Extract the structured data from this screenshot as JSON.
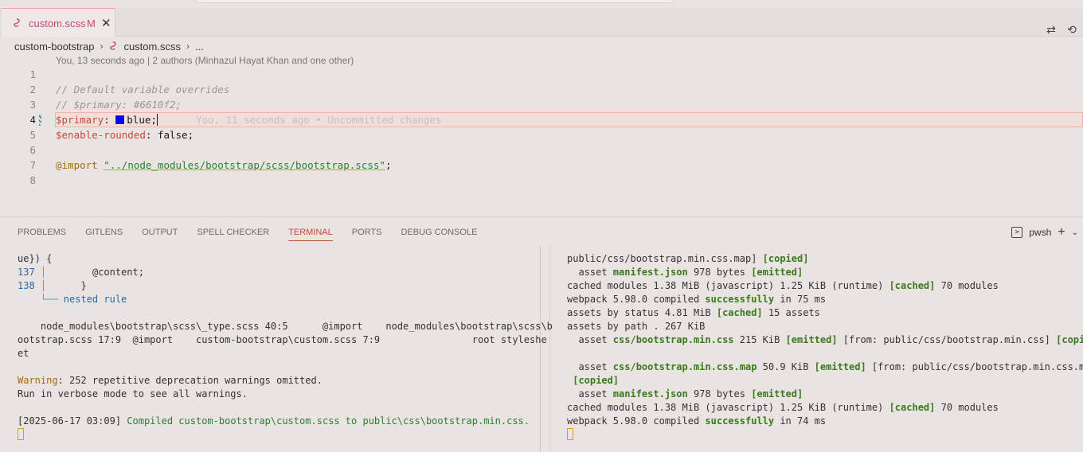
{
  "tab": {
    "filename": "custom.scss",
    "modified": "M",
    "close": "✕"
  },
  "breadcrumb": {
    "folder": "custom-bootstrap",
    "file": "custom.scss",
    "more": "..."
  },
  "blame": "You, 13 seconds ago | 2 authors (Minhazul Hayat Khan and one other)",
  "editor": {
    "lines": [
      {
        "n": "1"
      },
      {
        "n": "2",
        "comment": "// Default variable overrides"
      },
      {
        "n": "3",
        "comment": "// $primary: #6610f2;"
      },
      {
        "n": "4",
        "var": "$primary",
        "colon": ": ",
        "value": "blue",
        "semi": ";",
        "ghost": "You, 11 seconds ago • Uncommitted changes"
      },
      {
        "n": "5",
        "var": "$enable-rounded",
        "colon": ": ",
        "value": "false",
        "semi": ";"
      },
      {
        "n": "6"
      },
      {
        "n": "7",
        "kw": "@import",
        "str": "\"../node_modules/bootstrap/scss/bootstrap.scss\"",
        "semi": ";"
      },
      {
        "n": "8"
      }
    ],
    "swatch_color": "#0000ff"
  },
  "panel": {
    "tabs": [
      "PROBLEMS",
      "GITLENS",
      "OUTPUT",
      "SPELL CHECKER",
      "TERMINAL",
      "PORTS",
      "DEBUG CONSOLE"
    ],
    "active_tab": "TERMINAL",
    "shell": "pwsh"
  },
  "terminal_left": {
    "l1": "ue}) {",
    "l2_num": "137",
    "l2": "        @content;",
    "l3_num": "138",
    "l3": "      }",
    "l4": "nested rule",
    "l5": "    node_modules\\bootstrap\\scss\\_type.scss 40:5      @import    node_modules\\bootstrap\\scss\\b",
    "l6": "ootstrap.scss 17:9  @import    custom-bootstrap\\custom.scss 7:9                root styleshe",
    "l7": "et",
    "warn_label": "Warning",
    "warn_text": ": 252 repetitive deprecation warnings omitted.",
    "l9": "Run in verbose mode to see all warnings.",
    "ts": "[2025-06-17 03:09]",
    "compiled": " Compiled custom-bootstrap\\custom.scss to public\\css\\bootstrap.min.css."
  },
  "terminal_right": {
    "r1a": "public/css/bootstrap.min.css.map] ",
    "r1b": "[copied]",
    "r2a": "  asset ",
    "r2b": "manifest.json",
    "r2c": " 978 bytes ",
    "r2d": "[emitted]",
    "r3a": "cached modules 1.38 MiB (javascript) 1.25 KiB (runtime) ",
    "r3b": "[cached]",
    "r3c": " 70 modules",
    "r4a": "webpack 5.98.0 compiled ",
    "r4b": "successfully",
    "r4c": " in 75 ms",
    "r5a": "assets by status 4.81 MiB ",
    "r5b": "[cached]",
    "r5c": " 15 assets",
    "r6": "assets by path . 267 KiB",
    "r7a": "  asset ",
    "r7b": "css/bootstrap.min.css",
    "r7c": " 215 KiB ",
    "r7d": "[emitted]",
    "r7e": " [from: public/css/bootstrap.min.css] ",
    "r7f": "[copied]",
    "r8a": "  asset ",
    "r8b": "css/bootstrap.min.css.map",
    "r8c": " 50.9 KiB ",
    "r8d": "[emitted]",
    "r8e": " [from: public/css/bootstrap.min.css.map]",
    "r9": " [copied]",
    "r10a": "  asset ",
    "r10b": "manifest.json",
    "r10c": " 978 bytes ",
    "r10d": "[emitted]",
    "r11a": "cached modules 1.38 MiB (javascript) 1.25 KiB (runtime) ",
    "r11b": "[cached]",
    "r11c": " 70 modules",
    "r12a": "webpack 5.98.0 compiled ",
    "r12b": "successfully",
    "r12c": " in 74 ms"
  }
}
